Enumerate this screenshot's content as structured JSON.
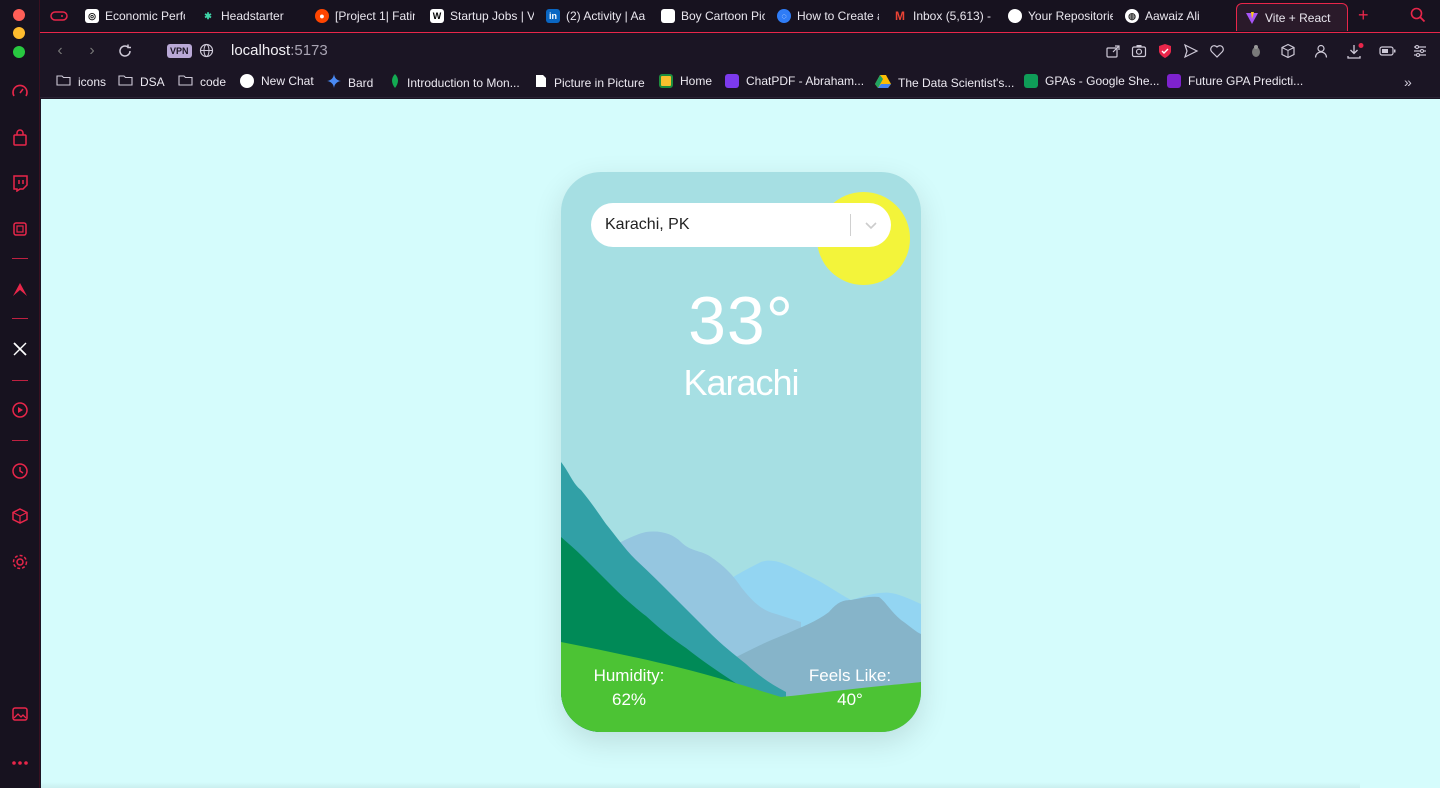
{
  "browser": {
    "tabs": [
      {
        "label": "Economic Perfo",
        "icon": "openai-icon",
        "active": false
      },
      {
        "label": "Headstarter",
        "icon": "headstarter-icon",
        "active": false
      },
      {
        "label": "[Project 1| Fatin",
        "icon": "reddit-icon",
        "active": false
      },
      {
        "label": "Startup Jobs | V",
        "icon": "wellfound-icon",
        "active": false
      },
      {
        "label": "(2) Activity | Aa",
        "icon": "linkedin-icon",
        "active": false
      },
      {
        "label": "Boy Cartoon Pic",
        "icon": "page-icon",
        "active": false
      },
      {
        "label": "How to Create a",
        "icon": "globe-icon",
        "active": false
      },
      {
        "label": "Inbox (5,613) - ",
        "icon": "gmail-icon",
        "active": false
      },
      {
        "label": "Your Repositorie",
        "icon": "github-icon",
        "active": false
      },
      {
        "label": "Aawaiz Ali",
        "icon": "globe-icon",
        "active": false
      },
      {
        "label": "Vite + React",
        "icon": "vite-icon",
        "active": true
      }
    ],
    "address": {
      "vpn_label": "VPN",
      "host": "localhost",
      "port": ":5173"
    },
    "bookmarks": [
      {
        "label": "icons",
        "icon": "folder-icon"
      },
      {
        "label": "DSA",
        "icon": "folder-icon"
      },
      {
        "label": "code",
        "icon": "folder-icon"
      },
      {
        "label": "New Chat",
        "icon": "openai-icon"
      },
      {
        "label": "Bard",
        "icon": "bard-icon"
      },
      {
        "label": "Introduction to Mon...",
        "icon": "mongodb-icon"
      },
      {
        "label": "Picture in Picture",
        "icon": "page-icon"
      },
      {
        "label": "Home",
        "icon": "classroom-icon"
      },
      {
        "label": "ChatPDF - Abraham...",
        "icon": "chatpdf-icon"
      },
      {
        "label": "The Data Scientist's...",
        "icon": "drive-icon"
      },
      {
        "label": "GPAs - Google She...",
        "icon": "sheets-icon"
      },
      {
        "label": "Future GPA Predicti...",
        "icon": "forms-icon"
      }
    ],
    "accent": "#e8264a"
  },
  "weather": {
    "location_select": "Karachi, PK",
    "temperature": "33°",
    "city": "Karachi",
    "humidity_label": "Humidity:",
    "humidity_value": "62%",
    "feels_like_label": "Feels Like:",
    "feels_like_value": "40°",
    "colors": {
      "page_bg": "#d5fcfc",
      "card_sky": "#a6dfe3",
      "sun": "#f3f43a",
      "grass": "#4cc334"
    }
  }
}
